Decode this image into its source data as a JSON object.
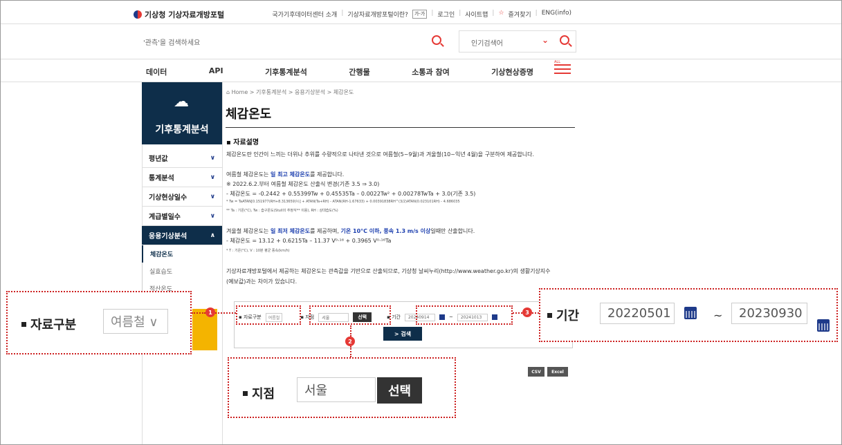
{
  "header": {
    "logo_text": "기상청 기상자료개방포털",
    "links": [
      "국가기후데이터센터 소개",
      "기상자료개방포털이란?",
      "가-가",
      "로그인",
      "사이트맵",
      "즐겨찾기",
      "ENG(info)"
    ]
  },
  "search": {
    "placeholder": "'관측'을 검색하세요",
    "popular_label": "인기검색어"
  },
  "nav": {
    "items": [
      "데이터",
      "API",
      "기후통계분석",
      "간행물",
      "소통과 참여",
      "기상현상증명"
    ],
    "all_label": "ALL"
  },
  "sidebar": {
    "title": "기후통계분석",
    "items": [
      "평년값",
      "통계분석",
      "기상현상일수",
      "계급별일수",
      "응용기상분석"
    ],
    "subitems": [
      "체감온도",
      "실효습도",
      "적산온도"
    ]
  },
  "content": {
    "breadcrumb": "⌂ Home  >  기후통계분석  >  응용기상분석  >  체감온도",
    "title": "체감온도",
    "section": "▪ 자료설명",
    "intro": "체감온도란 인간이 느끼는 더위나 추위를 수량적으로 나타낸 것으로 여름철(5~9월)과 겨울철(10~익년 4월)을 구분하여 제공합니다.",
    "summer_lead": "여름철 체감온도는 ",
    "summer_bold": "일 최고 체감온도",
    "summer_tail": "를 제공합니다.",
    "summer_note": "※ 2022.6.2.부터 여름철 체감온도 산출식 변경(기존 3.5 ⇒ 3.0)",
    "summer_formula": "- 체감온도 = -0.2442 + 0.55399Tw + 0.45535Ta – 0.0022Tw² + 0.00278TwTa + 3.0(기존 3.5)",
    "summer_tiny1": "* Tw = TaATAN[0.151977(RH+8.313659)½] + ATAN(Ta+RH) - ATAN(RH-1.67633) + 0.00391838RH^(3/2)ATAN(0.023101RH) - 4.686035",
    "summer_tiny2": "** Ta : 기온(°C), Tw : 습구온도(Stull의 추정식** 이용), RH : 상대습도(%)",
    "winter_lead": "겨울철 체감온도는 ",
    "winter_bold1": "일 최저 체감온도",
    "winter_mid": "를 제공하며, ",
    "winter_bold2": "기온 10°C 이하, 풍속 1.3 m/s 이상",
    "winter_tail": "일때만 산출합니다.",
    "winter_formula": "- 체감온도 = 13.12 + 0.6215Ta – 11.37 V⁰·¹⁶ + 0.3965 V⁰·¹⁶Ta",
    "winter_tiny": "* T : 기온(°C), V : 10분 평균 풍속(km/h)",
    "notice1": "기상자료개방포털에서 제공하는 체감온도는 관측값을 기반으로 산출되므로, 기상청 날씨누리(http://www.weather.go.kr)의 생활기상지수",
    "notice2": "(예보값)과는 차이가 있습니다."
  },
  "form": {
    "category_label": "자료구분",
    "category_value": "여름철",
    "station_label": "지점",
    "station_value": "서울",
    "select_button": "선택",
    "period_label": "기간",
    "period_start": "20240914",
    "period_end": "20241013",
    "tilde": "~",
    "search_button": "> 검색",
    "csv_button": "CSV",
    "excel_button": "Excel"
  },
  "callouts": {
    "badge1": "1",
    "badge2": "2",
    "badge3": "3",
    "zoom_category_label": "자료구분",
    "zoom_category_value": "여름철",
    "zoom_station_label": "지점",
    "zoom_station_value": "서울",
    "zoom_select_button": "선택",
    "zoom_period_label": "기간",
    "zoom_period_start": "20220501",
    "zoom_period_end": "20230930",
    "zoom_tilde": "~"
  }
}
